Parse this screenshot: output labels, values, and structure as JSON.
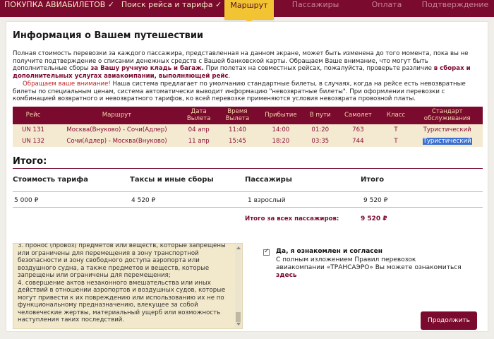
{
  "nav": {
    "steps": [
      {
        "label": "ПОКУПКА АВИАБИЛЕТОВ",
        "check": "✓",
        "state": "done"
      },
      {
        "label": "Поиск рейса и тарифа",
        "check": "✓",
        "state": "done"
      },
      {
        "label": "Маршрут",
        "check": "",
        "state": "active"
      },
      {
        "label": "Пассажиры",
        "check": "",
        "state": "pending"
      },
      {
        "label": "Оплата",
        "check": "",
        "state": "pending"
      },
      {
        "label": "Подтверждение",
        "check": "",
        "state": "pending"
      }
    ]
  },
  "page": {
    "title": "Информация о Вашем путешествии",
    "desc_1": "Полная стоимость перевозки за каждого пассажира, представленная на данном экране, может быть изменена до того момента, пока вы не получите подтверждение о списании денежных средств с Вашей банковской карты. Обращаем Ваше внимание, что могут быть дополнительные сборы ",
    "desc_1b": "за Вашу ручную кладь и багаж.",
    "desc_1c": " При полетах на совместных рейсах, пожалуйста, проверьте различие ",
    "desc_1d": "в сборах и дополнительных услугах авиакомпании, выполняющей рейс",
    "desc_1e": ".",
    "warn": "Обращаем ваше внимание!",
    "desc_2": " Наша система предлагает по умолчанию стандартные билеты, в случаях, когда на рейсе есть невозвратные билеты по специальным ценам, система автоматически выводит информацию \"невозвратные билеты\". При оформлении перевозки с комбинацией возвратного и невозвратного тарифов, ко всей перевозке применяются условия невозврата провозной платы."
  },
  "flights": {
    "headers": [
      "Рейс",
      "Маршрут",
      "Дата Вылета",
      "Время Вылета",
      "Прибытие",
      "В пути",
      "Самолет",
      "Класс",
      "Стандарт обслуживания"
    ],
    "rows": [
      [
        "UN 131",
        "Москва(Внуково) - Сочи(Адлер)",
        "04 апр",
        "11:40",
        "14:00",
        "01:20",
        "763",
        "T",
        "Туристический"
      ],
      [
        "UN 132",
        "Сочи(Адлер) - Москва(Внуково)",
        "11 апр",
        "15:45",
        "18:20",
        "03:35",
        "744",
        "T",
        "Туристический"
      ]
    ]
  },
  "summary": {
    "title": "Итого:",
    "headers": [
      "Стоимость тарифа",
      "Таксы и иные сборы",
      "Пассажиры",
      "Итого"
    ],
    "values": [
      "5 000 ₽",
      "4 520 ₽",
      "1 взрослый",
      "9 520 ₽"
    ],
    "total_label": "Итого за всех пассажиров:",
    "total_value": "9 520 ₽"
  },
  "rules": {
    "text": "3. пронос (провоз) предметов или веществ, которые запрещены или ограничены для перемещения в зону транспортной безопасности и зону свободного доступа аэропорта или воздушного судна, а также предметов и веществ, которые запрещены или ограничены для перемещения;\n4. совершение актов незаконного вмешательства или иных действий в отношении аэропортов и воздушных судов, которые могут привести к их повреждению или использованию их не по функциональному предназначению, влекущее за собой человеческие жертвы, материальный ущерб или возможность наступления таких последствий."
  },
  "agree": {
    "title": "Да, я ознакомлен и согласен",
    "text": "С полным изложением Правил перевозок авиакомпании «ТРАНСАЭРО» Вы можете ознакомиться ",
    "link": "здесь"
  },
  "actions": {
    "continue_label": "Продолжить"
  },
  "colors": {
    "brand": "#7a0a2e",
    "accent": "#f2c433",
    "row_bg": "#f4ead2"
  }
}
